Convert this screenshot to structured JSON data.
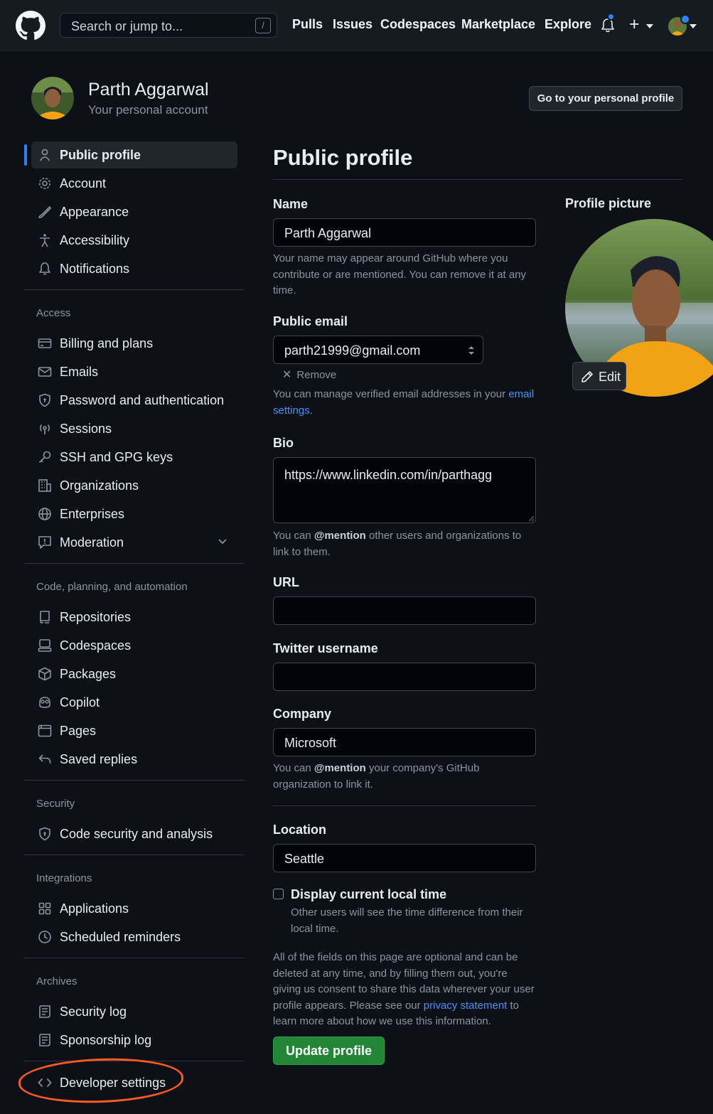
{
  "header": {
    "search_placeholder": "Search or jump to...",
    "search_shortcut": "/",
    "nav": [
      "Pulls",
      "Issues",
      "Codespaces",
      "Marketplace",
      "Explore"
    ],
    "plus": "+"
  },
  "account": {
    "name": "Parth Aggarwal",
    "subtitle": "Your personal account",
    "go_to_profile_button": "Go to your personal profile"
  },
  "sidebar": {
    "top_items": [
      {
        "label": "Public profile",
        "icon": "person-icon",
        "active": true
      },
      {
        "label": "Account",
        "icon": "gear-icon"
      },
      {
        "label": "Appearance",
        "icon": "paintbrush-icon"
      },
      {
        "label": "Accessibility",
        "icon": "accessibility-icon"
      },
      {
        "label": "Notifications",
        "icon": "bell-icon"
      }
    ],
    "access": {
      "heading": "Access",
      "items": [
        {
          "label": "Billing and plans",
          "icon": "credit-card-icon"
        },
        {
          "label": "Emails",
          "icon": "mail-icon"
        },
        {
          "label": "Password and authentication",
          "icon": "shield-lock-icon"
        },
        {
          "label": "Sessions",
          "icon": "broadcast-icon"
        },
        {
          "label": "SSH and GPG keys",
          "icon": "key-icon"
        },
        {
          "label": "Organizations",
          "icon": "organization-icon"
        },
        {
          "label": "Enterprises",
          "icon": "globe-icon"
        },
        {
          "label": "Moderation",
          "icon": "report-icon"
        }
      ]
    },
    "code": {
      "heading": "Code, planning, and automation",
      "items": [
        {
          "label": "Repositories",
          "icon": "repo-icon"
        },
        {
          "label": "Codespaces",
          "icon": "codespaces-icon"
        },
        {
          "label": "Packages",
          "icon": "package-icon"
        },
        {
          "label": "Copilot",
          "icon": "copilot-icon"
        },
        {
          "label": "Pages",
          "icon": "browser-icon"
        },
        {
          "label": "Saved replies",
          "icon": "reply-icon"
        }
      ]
    },
    "security": {
      "heading": "Security",
      "items": [
        {
          "label": "Code security and analysis",
          "icon": "shield-icon"
        }
      ]
    },
    "integrations": {
      "heading": "Integrations",
      "items": [
        {
          "label": "Applications",
          "icon": "apps-icon"
        },
        {
          "label": "Scheduled reminders",
          "icon": "clock-icon"
        }
      ]
    },
    "archives": {
      "heading": "Archives",
      "items": [
        {
          "label": "Security log",
          "icon": "log-icon"
        },
        {
          "label": "Sponsorship log",
          "icon": "log-icon"
        }
      ]
    },
    "developer": {
      "label": "Developer settings",
      "icon": "code-icon"
    }
  },
  "main": {
    "title": "Public profile",
    "name": {
      "label": "Name",
      "value": "Parth Aggarwal",
      "note": "Your name may appear around GitHub where you contribute or are mentioned. You can remove it at any time."
    },
    "email": {
      "label": "Public email",
      "value": "parth21999@gmail.com",
      "remove": "Remove",
      "note_prefix": "You can manage verified email addresses in your ",
      "note_link": "email settings",
      "note_suffix": "."
    },
    "bio": {
      "label": "Bio",
      "value": "https://www.linkedin.com/in/parthagg",
      "note_prefix": "You can ",
      "note_mention": "@mention",
      "note_suffix": " other users and organizations to link to them."
    },
    "url": {
      "label": "URL",
      "value": ""
    },
    "twitter": {
      "label": "Twitter username",
      "value": ""
    },
    "company": {
      "label": "Company",
      "value": "Microsoft",
      "note_prefix": "You can ",
      "note_mention": "@mention",
      "note_suffix": " your company's GitHub organization to link it."
    },
    "location": {
      "label": "Location",
      "value": "Seattle"
    },
    "local_time": {
      "label": "Display current local time",
      "checked": false,
      "note": "Other users will see the time difference from their local time."
    },
    "disclaimer_prefix": "All of the fields on this page are optional and can be deleted at any time, and by filling them out, you're giving us consent to share this data wherever your user profile appears. Please see our ",
    "disclaimer_link": "privacy statement",
    "disclaimer_suffix": " to learn more about how we use this information.",
    "update_button": "Update profile"
  },
  "profile_picture": {
    "label": "Profile picture",
    "edit": "Edit"
  },
  "colors": {
    "accent": "#2f81f7",
    "success": "#238636",
    "highlight_circle": "#ff5a1f"
  }
}
